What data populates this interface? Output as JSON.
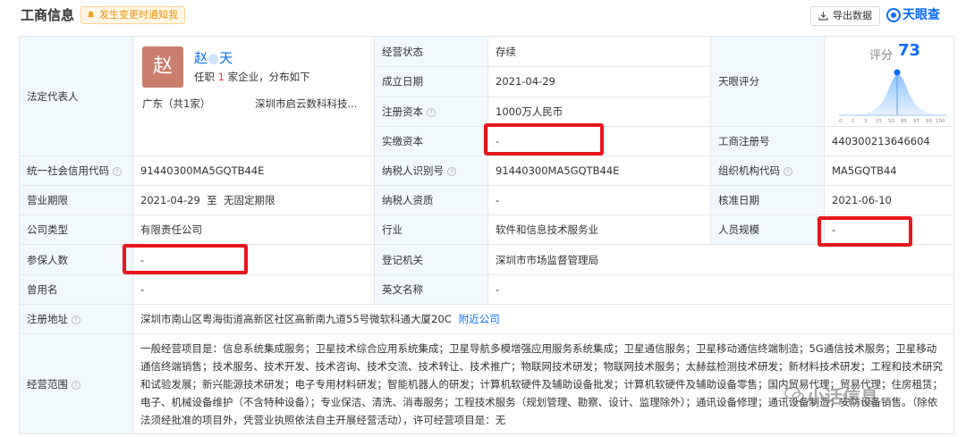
{
  "header": {
    "title": "工商信息",
    "notify_label": "发生变更时通知我",
    "export_label": "导出数据",
    "brand": "天眼查"
  },
  "rep": {
    "label": "法定代表人",
    "avatar_char": "赵",
    "name": "赵",
    "name_tail": "天",
    "count_prefix": "任职",
    "count": "1",
    "count_suffix": "家企业，分布如下",
    "region": "广东（共1家）",
    "company": "深圳市启云数科科技..."
  },
  "fields": {
    "status_label": "经营状态",
    "status": "存续",
    "founded_label": "成立日期",
    "founded": "2021-04-29",
    "capital_label": "注册资本",
    "capital": "1000万人民币",
    "paidin_label": "实缴资本",
    "paidin": "-",
    "score_label": "天眼评分",
    "regno_label": "工商注册号",
    "regno": "440300213646604",
    "credit_label": "统一社会信用代码",
    "credit": "91440300MA5GQTB44E",
    "taxid_label": "纳税人识别号",
    "taxid": "91440300MA5GQTB44E",
    "orgcode_label": "组织机构代码",
    "orgcode": "MA5GQTB44",
    "term_label": "营业期限",
    "term": "2021-04-29  至  无固定期限",
    "taxq_label": "纳税人资质",
    "taxq": "-",
    "approve_label": "核准日期",
    "approve": "2021-06-10",
    "type_label": "公司类型",
    "type": "有限责任公司",
    "industry_label": "行业",
    "industry": "软件和信息技术服务业",
    "staff_label": "人员规模",
    "staff": "-",
    "insured_label": "参保人数",
    "insured": "-",
    "authority_label": "登记机关",
    "authority": "深圳市市场监督管理局",
    "former_label": "曾用名",
    "former": "-",
    "english_label": "英文名称",
    "english": "-",
    "address_label": "注册地址",
    "address": "深圳市南山区粤海街道高新区社区高新南九道55号微软科通大厦20C",
    "address_link": "附近公司",
    "scope_label": "经营范围",
    "scope": "一般经营项目是：信息系统集成服务；卫星技术综合应用系统集成；卫星导航多模增强应用服务系统集成；卫星通信服务；卫星移动通信终端制造；5G通信技术服务；卫星移动通信终端销售；技术服务、技术开发、技术咨询、技术交流、技术转让、技术推广；物联网技术研发；物联网技术服务；太赫兹检测技术研发；新材料技术研发；工程和技术研究和试验发展；新兴能源技术研发；电子专用材料研发；智能机器人的研发；计算机软硬件及辅助设备批发；计算机软硬件及辅助设备零售；国内贸易代理；贸易代理；住房租赁；电子、机械设备维护（不含特种设备）；专业保洁、清洗、消毒服务；工程技术服务（规划管理、勘察、设计、监理除外）；通讯设备修理；通讯设备制造；安防设备销售。（除依法须经批准的项目外，凭营业执照依法自主开展经营活动），许可经营项目是：无"
  },
  "score": {
    "label": "评分",
    "value": "73",
    "ticks": [
      "0",
      "1",
      "3",
      "15",
      "50",
      "85",
      "97",
      "99",
      "100"
    ]
  },
  "watermark": "小话信息"
}
